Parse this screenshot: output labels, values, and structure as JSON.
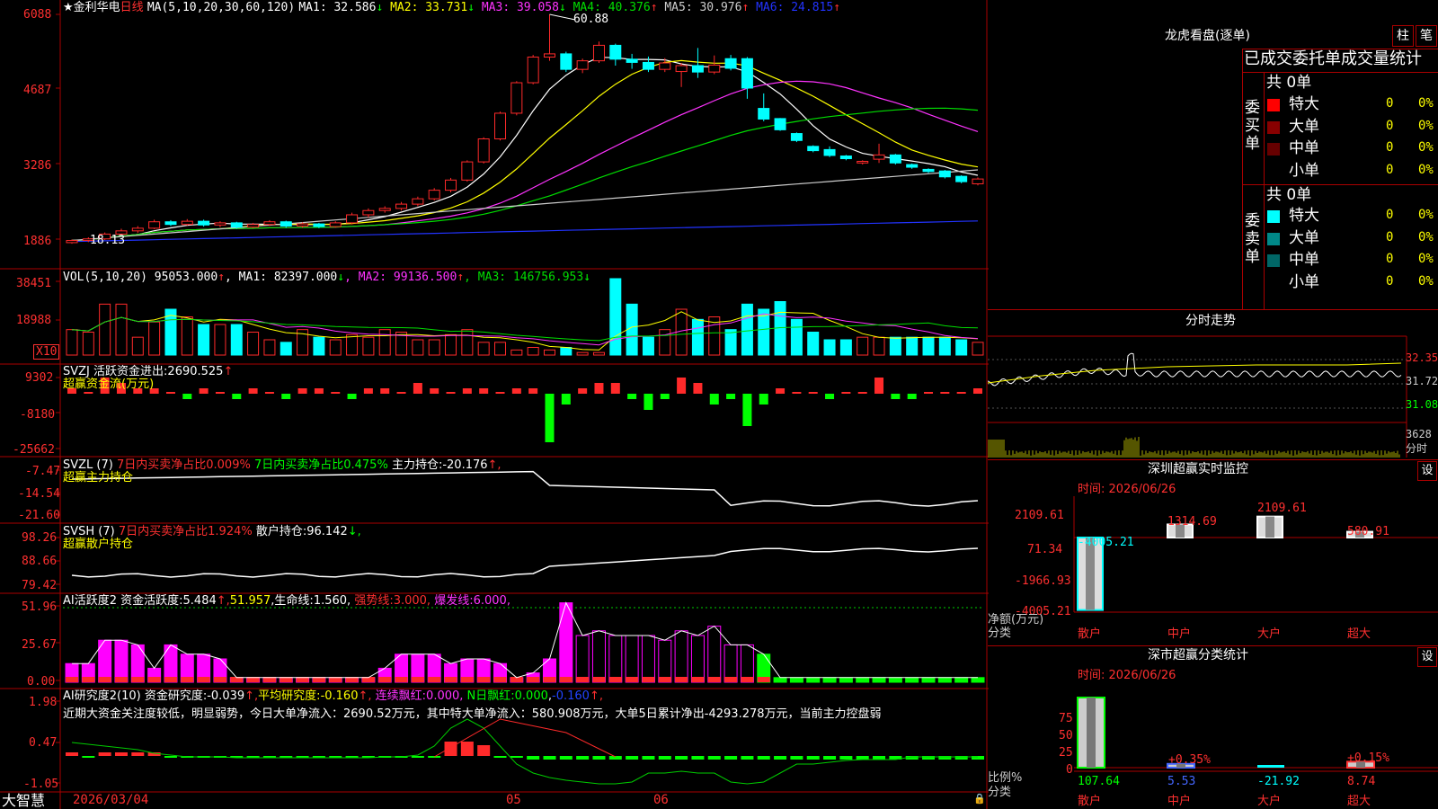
{
  "colors": {
    "bg": "#000000",
    "frame": "#aa0000",
    "up": "#ff2a2a",
    "down": "#00ffff",
    "ma1": "#ffffff",
    "ma2": "#ffff00",
    "ma3": "#ff33ff",
    "ma4": "#00dd00",
    "ma5": "#cccccc",
    "ma6": "#2233ff",
    "green": "#00ff00",
    "magenta": "#ff00ff",
    "yellow": "#ffff00"
  },
  "main": {
    "star": "★",
    "title": "金利华电",
    "period": "日线",
    "ma_label": "MA(5,10,20,30,60,120)",
    "ma": [
      {
        "name": "MA1:",
        "value": "32.586",
        "arrow": "↓",
        "color": "#ffffff"
      },
      {
        "name": "MA2:",
        "value": "33.731",
        "arrow": "↓",
        "color": "#ffff00"
      },
      {
        "name": "MA3:",
        "value": "39.058",
        "arrow": "↓",
        "color": "#ff33ff"
      },
      {
        "name": "MA4:",
        "value": "40.376",
        "arrow": "↑",
        "color": "#00dd00"
      },
      {
        "name": "MA5:",
        "value": "30.976",
        "arrow": "↑",
        "color": "#cccccc"
      },
      {
        "name": "MA6:",
        "value": "24.815",
        "arrow": "↑",
        "color": "#2233ff"
      }
    ],
    "y_labels": [
      "6088",
      "4687",
      "3286",
      "1886"
    ],
    "high_label": "60.88",
    "low_label": "18.13"
  },
  "vol": {
    "label": "VOL(5,10,20)",
    "value": "95053.000",
    "arrow": "↑",
    "ma": [
      {
        "name": "MA1:",
        "value": "82397.000",
        "arrow": "↓",
        "color": "#ffffff"
      },
      {
        "name": "MA2:",
        "value": "99136.500",
        "arrow": "↑",
        "color": "#ff33ff"
      },
      {
        "name": "MA3:",
        "value": "146756.953",
        "arrow": "↓",
        "color": "#00dd00"
      }
    ],
    "y_labels": [
      "38451",
      "18988"
    ],
    "unit": "X10"
  },
  "svzj": {
    "label": "SVZJ",
    "desc": "活跃资金进出:",
    "value": "2690.525",
    "arrow": "↑",
    "sub": "超赢资金流(万元)",
    "y_labels": [
      "9302",
      "-8180",
      "-25662"
    ]
  },
  "svzl": {
    "label": "SVZL (7)",
    "t1": "7日内买卖净占比0.009%",
    "t2": "7日内买卖净占比0.475%",
    "t3": "主力持仓:",
    "value": "-20.176",
    "arrow": "↑,",
    "sub": "超赢主力持仓",
    "y_labels": [
      "-7.47",
      "-14.54",
      "-21.60"
    ]
  },
  "svsh": {
    "label": "SVSH (7)",
    "t1": "7日内买卖净占比1.924%",
    "t2": "散户持仓:",
    "value": "96.142",
    "arrow": "↓,",
    "sub": "超赢散户持仓",
    "y_labels": [
      "98.26",
      "88.66",
      "79.42"
    ]
  },
  "ai1": {
    "label": "AI活跃度2",
    "t1": "资金活跃度:",
    "v1": "5.484",
    "a1": "↑,",
    "v2": "51.957",
    "t2": "生命线:",
    "v3": "1.560",
    "t3": "强势线:",
    "v4": "3.000",
    "t4": "爆发线:",
    "v5": "6.000",
    "y_labels": [
      "51.96",
      "25.67",
      "0.00"
    ]
  },
  "ai2": {
    "label": "AI研究度2(10)",
    "t1": "资金研究度:",
    "v1": "-0.039",
    "a1": "↑,",
    "t2": "平均研究度:",
    "v2": "-0.160",
    "a2": "↑,",
    "t3": "连续飘红:",
    "v3": "0.000",
    "t4": "N日飘红:",
    "v4": "0.000",
    "v5": "-0.160",
    "a5": "↑,",
    "comment": "近期大资金关注度较低，明显弱势，今日大单净流入：2690.52万元，其中特大单净流入：580.908万元，大单5日累计净出-4293.278万元，当前主力控盘弱",
    "y_labels": [
      "1.98",
      "0.47",
      "-1.05"
    ]
  },
  "footer": {
    "brand": "大智慧",
    "date": "2026/03/04",
    "m1": "05",
    "m2": "06"
  },
  "right": {
    "lhb_title": "龙虎看盘(逐单)",
    "btn1": "柱",
    "btn2": "笔",
    "table_title": "已成交委托单成交量统计",
    "buy_label": "委买单",
    "sell_label": "委卖单",
    "buy_total": "共 0单",
    "sell_total": "共 0单",
    "buy_rows": [
      {
        "name": "特大",
        "qty": "0",
        "pct": "0%",
        "color": "#ff0000"
      },
      {
        "name": "大单",
        "qty": "0",
        "pct": "0%",
        "color": "#880000"
      },
      {
        "name": "中单",
        "qty": "0",
        "pct": "0%",
        "color": "#660000"
      },
      {
        "name": "小单",
        "qty": "0",
        "pct": "0%",
        "color": "#000000"
      }
    ],
    "sell_rows": [
      {
        "name": "特大",
        "qty": "0",
        "pct": "0%",
        "color": "#00ffff"
      },
      {
        "name": "大单",
        "qty": "0",
        "pct": "0%",
        "color": "#008888"
      },
      {
        "name": "中单",
        "qty": "0",
        "pct": "0%",
        "color": "#006666"
      },
      {
        "name": "小单",
        "qty": "0",
        "pct": "0%",
        "color": "#000000"
      }
    ],
    "intraday_title": "分时走势",
    "intraday_y": [
      "32.35",
      "31.72",
      "31.08"
    ],
    "intraday_vol": "3628",
    "intraday_unit": "分时",
    "sz_title": "深圳超赢实时监控",
    "sz_btn": "设",
    "sz_time": "时间: 2026/06/26",
    "sz_y": [
      "2109.61",
      "71.34",
      "-1966.93",
      "-4005.21"
    ],
    "sz_unit": "净额(万元)",
    "sz_cat": "分类",
    "sz_bars": [
      {
        "label": "散户",
        "value": "-4005.21",
        "color": "#00ffff"
      },
      {
        "label": "中户",
        "value": "1314.69",
        "color": "#ffffff"
      },
      {
        "label": "大户",
        "value": "2109.61",
        "color": "#ffffff"
      },
      {
        "label": "超大",
        "value": "580.91",
        "color": "#ffffff"
      }
    ],
    "st_title": "深市超赢分类统计",
    "st_btn": "设",
    "st_time": "时间: 2026/06/26",
    "st_y": [
      "75",
      "50",
      "25",
      "0"
    ],
    "st_unit": "比例%",
    "st_cat": "分类",
    "st_bars": [
      {
        "label": "散户",
        "value": "107.64",
        "pct": "",
        "color": "#00ff00"
      },
      {
        "label": "中户",
        "value": "5.53",
        "pct": "+0.35%",
        "color": "#4466ff"
      },
      {
        "label": "大户",
        "value": "-21.92",
        "pct": "",
        "color": "#00ffff"
      },
      {
        "label": "超大",
        "value": "8.74",
        "pct": "+0.15%",
        "color": "#ff3333"
      }
    ]
  },
  "chart_data": {
    "type": "candlestick",
    "title": "金利华电 日线",
    "ylim": [
      18.13,
      60.88
    ],
    "candles": [
      [
        18.2,
        18.6,
        18.0,
        18.8
      ],
      [
        18.6,
        18.9,
        18.3,
        19.2
      ],
      [
        18.9,
        19.8,
        18.7,
        20.1
      ],
      [
        19.8,
        20.4,
        19.5,
        20.8
      ],
      [
        20.4,
        20.9,
        20.0,
        21.3
      ],
      [
        20.9,
        22.1,
        20.7,
        22.5
      ],
      [
        22.1,
        21.6,
        21.3,
        22.4
      ],
      [
        21.6,
        22.2,
        21.4,
        22.6
      ],
      [
        22.2,
        21.5,
        21.2,
        22.5
      ],
      [
        21.5,
        21.9,
        21.1,
        22.2
      ],
      [
        21.9,
        21.1,
        20.8,
        22.1
      ],
      [
        21.1,
        21.6,
        20.9,
        21.9
      ],
      [
        21.6,
        22.1,
        21.3,
        22.4
      ],
      [
        22.1,
        21.3,
        21.0,
        22.3
      ],
      [
        21.3,
        21.7,
        21.0,
        22.0
      ],
      [
        21.7,
        21.2,
        20.9,
        21.9
      ],
      [
        21.2,
        21.9,
        21.0,
        22.2
      ],
      [
        21.9,
        23.4,
        21.6,
        23.8
      ],
      [
        23.4,
        24.2,
        22.9,
        24.6
      ],
      [
        24.2,
        24.6,
        23.8,
        25.0
      ],
      [
        24.6,
        25.4,
        24.2,
        25.8
      ],
      [
        25.4,
        26.4,
        25.0,
        26.8
      ],
      [
        26.4,
        28.0,
        26.1,
        28.4
      ],
      [
        28.0,
        29.9,
        27.6,
        30.3
      ],
      [
        29.9,
        33.3,
        29.6,
        33.6
      ],
      [
        33.3,
        37.6,
        33.0,
        37.9
      ],
      [
        37.6,
        42.4,
        37.3,
        42.7
      ],
      [
        42.4,
        48.1,
        42.0,
        48.4
      ],
      [
        48.1,
        52.9,
        47.8,
        53.3
      ],
      [
        52.9,
        53.5,
        52.2,
        60.88
      ],
      [
        53.5,
        50.6,
        50.1,
        53.9
      ],
      [
        50.6,
        52.2,
        49.9,
        52.6
      ],
      [
        52.2,
        55.1,
        51.8,
        55.8
      ],
      [
        55.1,
        52.5,
        51.3,
        55.4
      ],
      [
        52.5,
        51.9,
        50.7,
        53.5
      ],
      [
        51.9,
        50.6,
        50.1,
        53.0
      ],
      [
        50.6,
        51.8,
        50.1,
        52.7
      ],
      [
        50.2,
        51.3,
        47.3,
        51.8
      ],
      [
        51.3,
        50.1,
        49.0,
        54.6
      ],
      [
        50.1,
        51.4,
        49.7,
        53.2
      ],
      [
        52.6,
        50.8,
        50.4,
        53.3
      ],
      [
        52.6,
        47.1,
        45.1,
        52.9
      ],
      [
        43.3,
        41.3,
        40.9,
        46.1
      ],
      [
        41.4,
        39.3,
        39.1,
        41.5
      ],
      [
        38.6,
        37.3,
        37.0,
        38.8
      ],
      [
        36.2,
        35.4,
        35.1,
        36.4
      ],
      [
        35.6,
        34.5,
        34.2,
        36.2
      ],
      [
        34.4,
        33.9,
        33.6,
        34.6
      ],
      [
        33.1,
        33.4,
        32.8,
        33.6
      ],
      [
        33.8,
        34.6,
        33.1,
        36.7
      ],
      [
        34.6,
        33.1,
        32.8,
        34.8
      ],
      [
        32.8,
        32.3,
        32.0,
        33.0
      ],
      [
        31.9,
        31.5,
        31.2,
        32.1
      ],
      [
        31.6,
        30.5,
        30.2,
        31.8
      ],
      [
        30.6,
        29.6,
        29.3,
        30.8
      ],
      [
        29.2,
        30.1,
        28.9,
        30.4
      ]
    ]
  }
}
